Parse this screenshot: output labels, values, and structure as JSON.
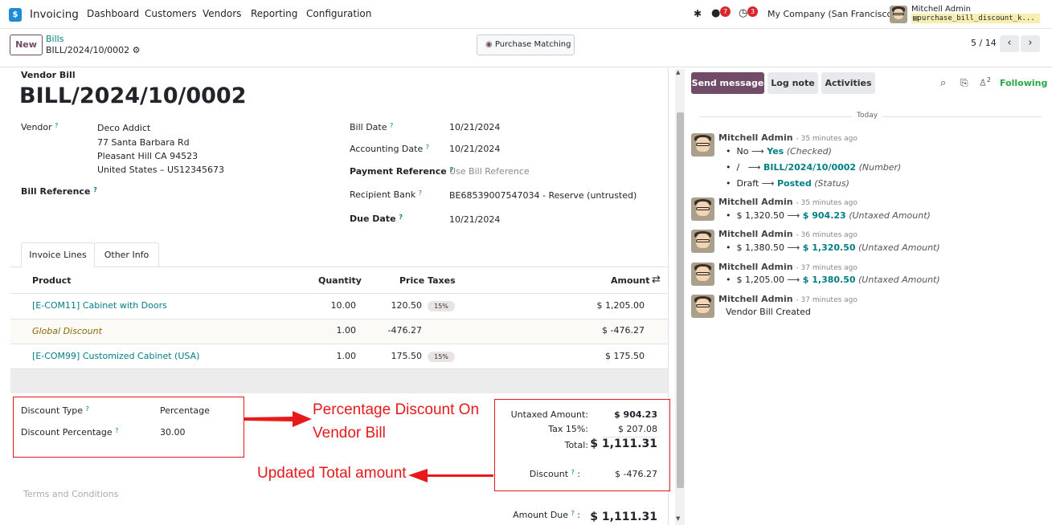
{
  "app": {
    "name": "Invoicing",
    "icon": "invoicing-app-icon"
  },
  "menu": [
    "Dashboard",
    "Customers",
    "Vendors",
    "Reporting",
    "Configuration"
  ],
  "systray": {
    "chat_count": "7",
    "activity_count": "3",
    "company": "My Company (San Francisco)",
    "user": "Mitchell Admin",
    "db": "purchase_bill_discount_k..."
  },
  "control": {
    "new_label": "New",
    "breadcrumb_parent": "Bills",
    "breadcrumb_current": "BILL/2024/10/0002",
    "purchase_matching": "Purchase Matching",
    "pager": "5 / 14"
  },
  "form": {
    "type_label": "Vendor Bill",
    "name": "BILL/2024/10/0002",
    "vendor_label": "Vendor",
    "vendor_name": "Deco Addict",
    "vendor_address": [
      "77 Santa Barbara Rd",
      "Pleasant Hill CA 94523",
      "United States – US12345673"
    ],
    "bill_reference_label": "Bill Reference",
    "bill_date_label": "Bill Date",
    "bill_date": "10/21/2024",
    "accounting_date_label": "Accounting Date",
    "accounting_date": "10/21/2024",
    "payment_reference_label": "Payment Reference",
    "payment_reference_placeholder": "Use Bill Reference",
    "recipient_bank_label": "Recipient Bank",
    "recipient_bank": "BE68539007547034 - Reserve (untrusted)",
    "due_date_label": "Due Date",
    "due_date": "10/21/2024"
  },
  "tabs": [
    "Invoice Lines",
    "Other Info"
  ],
  "lines": {
    "headers": {
      "product": "Product",
      "quantity": "Quantity",
      "price": "Price",
      "taxes": "Taxes",
      "amount": "Amount"
    },
    "rows": [
      {
        "product": "[E-COM11] Cabinet with Doors",
        "quantity": "10.00",
        "price": "120.50",
        "tax": "15%",
        "amount": "$ 1,205.00"
      },
      {
        "product": "Global Discount",
        "quantity": "1.00",
        "price": "-476.27",
        "tax": "",
        "amount": "$ -476.27"
      },
      {
        "product": "[E-COM99] Customized Cabinet (USA)",
        "quantity": "1.00",
        "price": "175.50",
        "tax": "15%",
        "amount": "$ 175.50"
      }
    ]
  },
  "discount": {
    "type_label": "Discount Type",
    "type_value": "Percentage",
    "pct_label": "Discount Percentage",
    "pct_value": "30.00"
  },
  "annotations": {
    "pct_line1": "Percentage Discount On",
    "pct_line2": "Vendor Bill",
    "total": "Updated Total amount"
  },
  "totals": {
    "untaxed_label": "Untaxed Amount:",
    "untaxed": "$ 904.23",
    "tax_label": "Tax 15%:",
    "tax": "$ 207.08",
    "total_label": "Total:",
    "total": "$ 1,111.31",
    "discount_label": "Discount",
    "discount": "$ -476.27",
    "amount_due_label": "Amount Due",
    "amount_due": "$ 1,111.31"
  },
  "terms_placeholder": "Terms and Conditions",
  "chatter": {
    "send_message": "Send message",
    "log_note": "Log note",
    "activities": "Activities",
    "followers_count": "2",
    "following": "Following",
    "date_sep": "Today",
    "messages": [
      {
        "author": "Mitchell Admin",
        "time": "- 35 minutes ago",
        "changes": [
          {
            "old": "No",
            "new": "Yes",
            "field": "(Checked)"
          },
          {
            "old": "/",
            "new": "BILL/2024/10/0002",
            "field": "(Number)"
          },
          {
            "old": "Draft",
            "new": "Posted",
            "field": "(Status)"
          }
        ]
      },
      {
        "author": "Mitchell Admin",
        "time": "- 35 minutes ago",
        "changes": [
          {
            "old": "$ 1,320.50",
            "new": "$ 904.23",
            "field": "(Untaxed Amount)"
          }
        ]
      },
      {
        "author": "Mitchell Admin",
        "time": "- 36 minutes ago",
        "changes": [
          {
            "old": "$ 1,380.50",
            "new": "$ 1,320.50",
            "field": "(Untaxed Amount)"
          }
        ]
      },
      {
        "author": "Mitchell Admin",
        "time": "- 37 minutes ago",
        "changes": [
          {
            "old": "$ 1,205.00",
            "new": "$ 1,380.50",
            "field": "(Untaxed Amount)"
          }
        ]
      },
      {
        "author": "Mitchell Admin",
        "time": "- 37 minutes ago",
        "body": "Vendor Bill Created"
      }
    ]
  }
}
